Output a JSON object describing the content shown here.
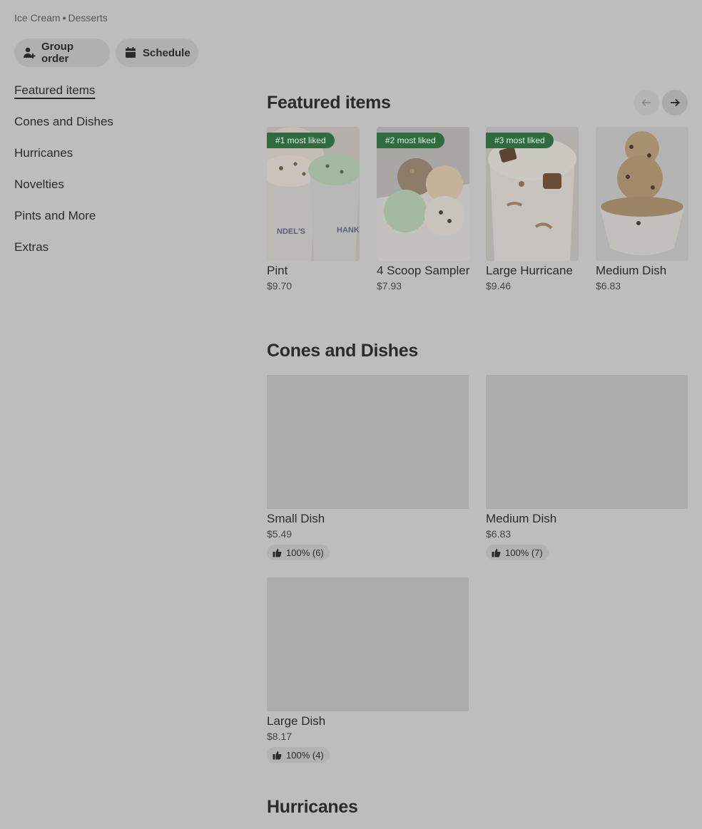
{
  "breadcrumb": {
    "first": "Ice Cream",
    "separator": "•",
    "second": "Desserts"
  },
  "actions": {
    "group_order": "Group order",
    "schedule": "Schedule"
  },
  "nav": {
    "items": [
      {
        "label": "Featured items",
        "active": true
      },
      {
        "label": "Cones and Dishes"
      },
      {
        "label": "Hurricanes"
      },
      {
        "label": "Novelties"
      },
      {
        "label": "Pints and More"
      },
      {
        "label": "Extras"
      }
    ]
  },
  "featured": {
    "title": "Featured items",
    "items": [
      {
        "badge": "#1 most liked",
        "name": "Pint",
        "price": "$9.70"
      },
      {
        "badge": "#2 most liked",
        "name": "4 Scoop Sampler",
        "price": "$7.93"
      },
      {
        "badge": "#3 most liked",
        "name": "Large Hurricane",
        "price": "$9.46"
      },
      {
        "name": "Medium Dish",
        "price": "$6.83"
      }
    ]
  },
  "cones": {
    "title": "Cones and Dishes",
    "items": [
      {
        "name": "Small Dish",
        "price": "$5.49",
        "rating": "100% (6)"
      },
      {
        "name": "Medium Dish",
        "price": "$6.83",
        "rating": "100% (7)"
      },
      {
        "name": "Large Dish",
        "price": "$8.17",
        "rating": "100% (4)"
      }
    ]
  },
  "hurricanes": {
    "title": "Hurricanes"
  },
  "colors": {
    "badge_bg": "#2f6b3f",
    "overlay_gray": "#bdbdbd"
  }
}
